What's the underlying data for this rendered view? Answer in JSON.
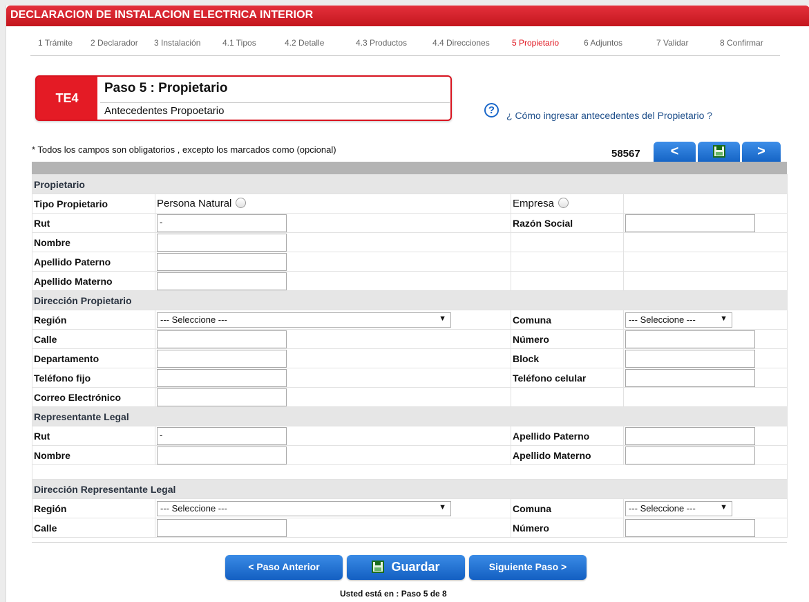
{
  "page_title": "DECLARACION DE INSTALACION ELECTRICA INTERIOR",
  "steps": [
    "1 Trámite",
    "2 Declarador",
    "3 Instalación",
    "4.1 Tipos",
    "4.2 Detalle",
    "4.3 Productos",
    "4.4 Direcciones",
    "5 Propietario",
    "6 Adjuntos",
    "7 Validar",
    "8 Confirmar"
  ],
  "active_step": "5 Propietario",
  "header": {
    "tag": "TE4",
    "title": "Paso 5 : Propietario",
    "subtitle": "Antecedentes Propoetario"
  },
  "help_link": "¿ Cómo ingresar antecedentes del Propietario ?",
  "required_note": "* Todos los campos son obligatorios , excepto los marcados como (opcional)",
  "record_id": "58567",
  "nav": {
    "prev": "<",
    "next": ">",
    "save_icon": "floppy-disk-icon"
  },
  "sections": {
    "propietario": "Propietario",
    "direccion_propietario": "Dirección Propietario",
    "representante": "Representante Legal",
    "direccion_representante": "Dirección Representante Legal"
  },
  "labels": {
    "tipo_propietario": "Tipo Propietario",
    "persona_natural": "Persona Natural",
    "empresa": "Empresa",
    "rut": "Rut",
    "razon_social": "Razón Social",
    "nombre": "Nombre",
    "apellido_paterno": "Apellido Paterno",
    "apellido_materno": "Apellido Materno",
    "region": "Región",
    "comuna": "Comuna",
    "calle": "Calle",
    "numero": "Número",
    "departamento": "Departamento",
    "block": "Block",
    "telefono_fijo": "Teléfono fijo",
    "telefono_celular": "Teléfono celular",
    "correo": "Correo Electrónico"
  },
  "values": {
    "rut_propietario": "-",
    "rut_representante": "-",
    "region_select": "--- Seleccione ---",
    "comuna_select": "--- Seleccione ---"
  },
  "buttons": {
    "prev": "< Paso Anterior",
    "save": "Guardar",
    "next": "Siguiente Paso >"
  },
  "status": "Usted está en : Paso 5 de 8",
  "colors": {
    "primary_red": "#e41b25",
    "primary_blue": "#1a67c9",
    "active_step": "#e0141e"
  }
}
